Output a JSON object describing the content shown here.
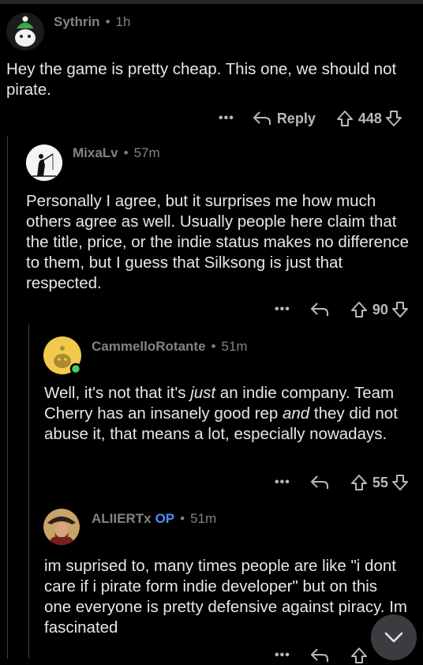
{
  "comments": [
    {
      "author": "Sythrin",
      "time": "1h",
      "body": "Hey the game is pretty cheap. This one, we should not pirate.",
      "reply_label": "Reply",
      "votes": "448"
    },
    {
      "author": "MixaLv",
      "time": "57m",
      "body": "Personally I agree, but it surprises me how much others agree as well. Usually people here claim that the title, price, or the indie status makes no difference to them, but I guess that Silksong is just that respected.",
      "votes": "90"
    },
    {
      "author": "CammelloRotante",
      "time": "51m",
      "body_part1": "Well, it's not that it's ",
      "body_em1": "just",
      "body_part2": " an indie company. Team Cherry has an insanely good rep ",
      "body_em2": "and",
      "body_part3": " they did not abuse it, that means a lot, especially nowadays.",
      "votes": "55"
    },
    {
      "author": "ALIIERTx",
      "op_badge": "OP",
      "time": "51m",
      "body": "im suprised to,  many times people are like \"i dont care if i pirate form indie developer\" but on this one everyone is pretty defensive against piracy. Im fascinated"
    }
  ],
  "more_label": "•••",
  "dot": "•",
  "colors": {
    "background": "#000000",
    "op": "#4f8bff",
    "meta": "#818384"
  }
}
